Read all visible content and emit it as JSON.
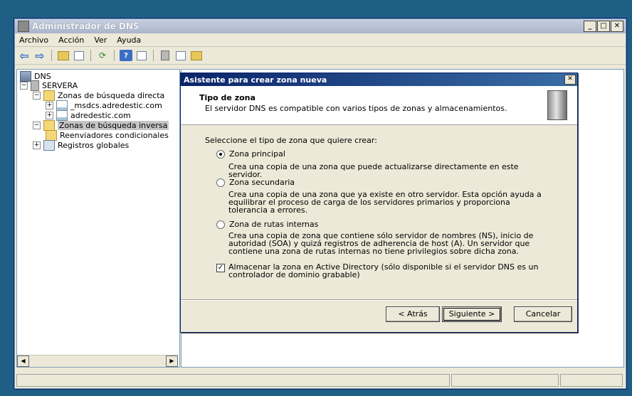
{
  "window": {
    "title": "Administrador de DNS",
    "controls": [
      "_",
      "□",
      "✕"
    ]
  },
  "menu": [
    "Archivo",
    "Acción",
    "Ver",
    "Ayuda"
  ],
  "tree": {
    "root": "DNS",
    "server": "SERVERA",
    "forward_zones": "Zonas de búsqueda directa",
    "zone1": "_msdcs.adredestic.com",
    "zone2": "adredestic.com",
    "reverse_zones": "Zonas de búsqueda inversa",
    "conditional": "Reenviadores condicionales",
    "global": "Registros globales"
  },
  "dialog": {
    "title": "Asistente para crear zona nueva",
    "heading": "Tipo de zona",
    "subheading": "El servidor DNS es compatible con varios tipos de zonas y almacenamientos.",
    "prompt": "Seleccione el tipo de zona que quiere crear:",
    "primary_label": "Zona principal",
    "primary_desc": "Crea una copia de una zona que puede actualizarse directamente en este servidor.",
    "secondary_label": "Zona secundaria",
    "secondary_desc": "Crea una copia de una zona que ya existe en otro servidor. Esta opción ayuda a equilibrar el proceso de carga de los servidores primarios y proporciona tolerancia a errores.",
    "stub_label": "Zona de rutas internas",
    "stub_desc": "Crea una copia de zona que contiene sólo servidor de nombres (NS), inicio de autoridad (SOA) y quizá registros de adherencia de host (A). Un servidor que contiene una zona de rutas internas no tiene privilegios sobre dicha zona.",
    "ad_label": "Almacenar la zona en Active Directory (sólo disponible si el servidor DNS es un controlador de dominio grabable)",
    "back": "< Atrás",
    "next": "Siguiente >",
    "cancel": "Cancelar",
    "close": "✕"
  }
}
